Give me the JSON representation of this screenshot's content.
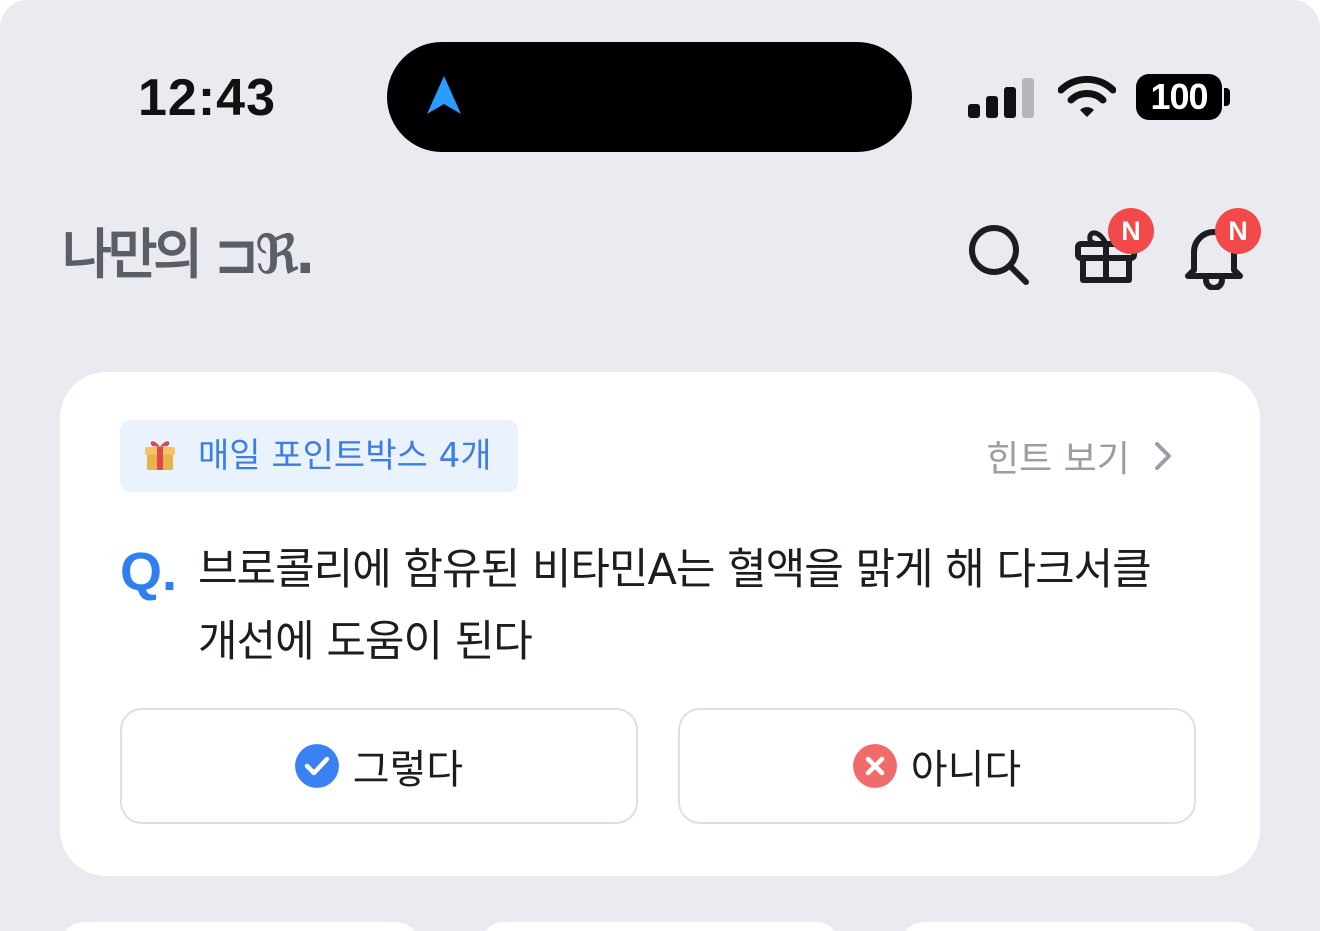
{
  "status_bar": {
    "time": "12:43",
    "battery": "100"
  },
  "header": {
    "logo": "나만의 ⊐ℜ.",
    "search_icon": "search-icon",
    "gift_badge": "N",
    "bell_badge": "N"
  },
  "quiz": {
    "points_chip": "매일 포인트박스 4개",
    "hint": "힌트 보기",
    "q_mark": "Q.",
    "question": "브로콜리에 함유된 비타민A는 혈액을 맑게 해 다크서클 개선에 도움이 된다",
    "yes_label": "그렇다",
    "no_label": "아니다"
  },
  "colors": {
    "background": "#e9ebf0",
    "accent": "#2f7ff0",
    "badge": "#f24a4a",
    "no_icon": "#f26b6b"
  }
}
